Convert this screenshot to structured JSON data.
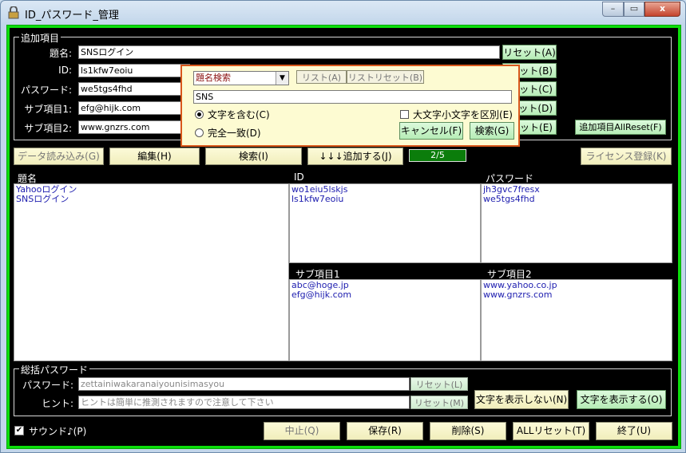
{
  "window": {
    "title": "ID_パスワード_管理",
    "min": "–",
    "max": "▭",
    "close": "x"
  },
  "add_group": {
    "title": "追加項目",
    "fields": [
      {
        "label": "題名:",
        "value": "SNSログイン",
        "reset": "リセット(A)"
      },
      {
        "label": "ID:",
        "value": "ls1kfw7eoiu",
        "reset": "セット(B)"
      },
      {
        "label": "パスワード:",
        "value": "we5tgs4fhd",
        "reset": "セット(C)"
      },
      {
        "label": "サブ項目1:",
        "value": "efg@hijk.com",
        "reset": "セット(D)"
      },
      {
        "label": "サブ項目2:",
        "value": "www.gnzrs.com",
        "reset": "セット(E)"
      }
    ],
    "all_reset": "追加項目AllReset(F)"
  },
  "toolbar": {
    "load": "データ読み込み(G)",
    "edit": "編集(H)",
    "search": "検索(I)",
    "add": "↓↓↓追加する(J)",
    "counter": "2/5",
    "license": "ライセンス登録(K)"
  },
  "columns": {
    "title": "題名",
    "id": "ID",
    "password": "パスワード",
    "sub1": "サブ項目1",
    "sub2": "サブ項目2"
  },
  "lists": {
    "title": [
      "Yahooログイン",
      "SNSログイン"
    ],
    "id": [
      "wo1eiu5lskjs",
      "ls1kfw7eoiu"
    ],
    "password": [
      "jh3gvc7fresx",
      "we5tgs4fhd"
    ],
    "sub1": [
      "abc@hoge.jp",
      "efg@hijk.com"
    ],
    "sub2": [
      "www.yahoo.co.jp",
      "www.gnzrs.com"
    ]
  },
  "master": {
    "title": "総括パスワード",
    "pw_label": "パスワード:",
    "pw_value": "zettainiwakaranaiyounisimasyou",
    "pw_reset": "リセット(L)",
    "hint_label": "ヒント:",
    "hint_value": "ヒントは簡単に推測されますので注意して下さい",
    "hint_reset": "リセット(M)",
    "hide": "文字を表示しない(N)",
    "show": "文字を表示する(O)"
  },
  "bottom": {
    "sound": "サウンド♪(P)",
    "sound_check": "✔",
    "stop": "中止(Q)",
    "save": "保存(R)",
    "delete": "削除(S)",
    "allreset": "ALLリセット(T)",
    "exit": "終了(U)"
  },
  "search_popup": {
    "mode": "題名検索",
    "mode_arrow": "▼",
    "list": "リスト(A)",
    "list_reset": "リストリセット(B)",
    "query": "SNS",
    "contains": "文字を含む(C)",
    "exact": "完全一致(D)",
    "case": "大文字小文字を区別(E)",
    "cancel": "キャンセル(F)",
    "search": "検索(G)"
  }
}
